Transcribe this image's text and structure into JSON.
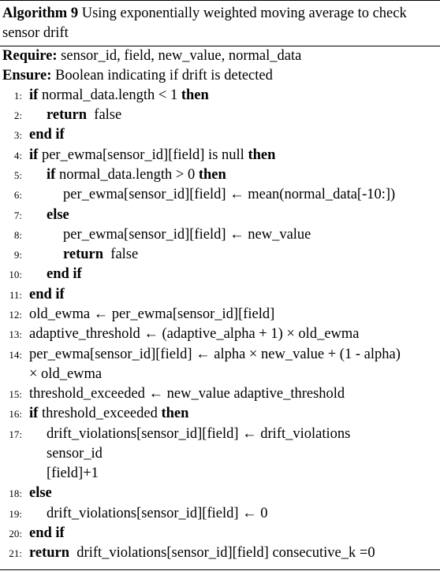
{
  "caption": {
    "label": "Algorithm 9",
    "title": "Using exponentially weighted moving average to check sensor drift"
  },
  "require": {
    "keyword": "Require:",
    "text": "sensor_id, field, new_value, normal_data"
  },
  "ensure": {
    "keyword": "Ensure:",
    "text": "Boolean indicating if drift is detected"
  },
  "lines": [
    {
      "num": "1:",
      "kw1": "if",
      "text": "normal_data.length < 1",
      "kw2": "then"
    },
    {
      "num": "2:",
      "kw1": "return",
      "text": "false"
    },
    {
      "num": "3:",
      "kw1": "end if"
    },
    {
      "num": "4:",
      "kw1": "if",
      "text": "per_ewma[sensor_id][field] is null",
      "kw2": "then"
    },
    {
      "num": "5:",
      "kw1": "if",
      "text": "normal_data.length > 0",
      "kw2": "then"
    },
    {
      "num": "6:",
      "text": "per_ewma[sensor_id][field] ← mean(normal_data[-10:])"
    },
    {
      "num": "7:",
      "kw1": "else"
    },
    {
      "num": "8:",
      "text": "per_ewma[sensor_id][field] ← new_value"
    },
    {
      "num": "9:",
      "kw1": "return",
      "text": "false"
    },
    {
      "num": "10:",
      "kw1": "end if"
    },
    {
      "num": "11:",
      "kw1": "end if"
    },
    {
      "num": "12:",
      "text": "old_ewma ← per_ewma[sensor_id][field]"
    },
    {
      "num": "13:",
      "text": "adaptive_threshold ← (adaptive_alpha + 1) × old_ewma"
    },
    {
      "num": "14:",
      "text": "per_ewma[sensor_id][field] ← alpha × new_value + (1 - alpha)",
      "cont": "× old_ewma"
    },
    {
      "num": "15:",
      "text": "threshold_exceeded ← new_value  adaptive_threshold"
    },
    {
      "num": "16:",
      "kw1": "if",
      "text": "threshold_exceeded",
      "kw2": "then"
    },
    {
      "num": "17:",
      "text": "drift_violations[sensor_id][field] ← drift_violations",
      "cont": "sensor_id",
      "cont2": "[field]+1"
    },
    {
      "num": "18:",
      "kw1": "else"
    },
    {
      "num": "19:",
      "text": "drift_violations[sensor_id][field] ← 0"
    },
    {
      "num": "20:",
      "kw1": "end if"
    },
    {
      "num": "21:",
      "kw1": "return",
      "text": "drift_violations[sensor_id][field]  consecutive_k =0"
    }
  ]
}
